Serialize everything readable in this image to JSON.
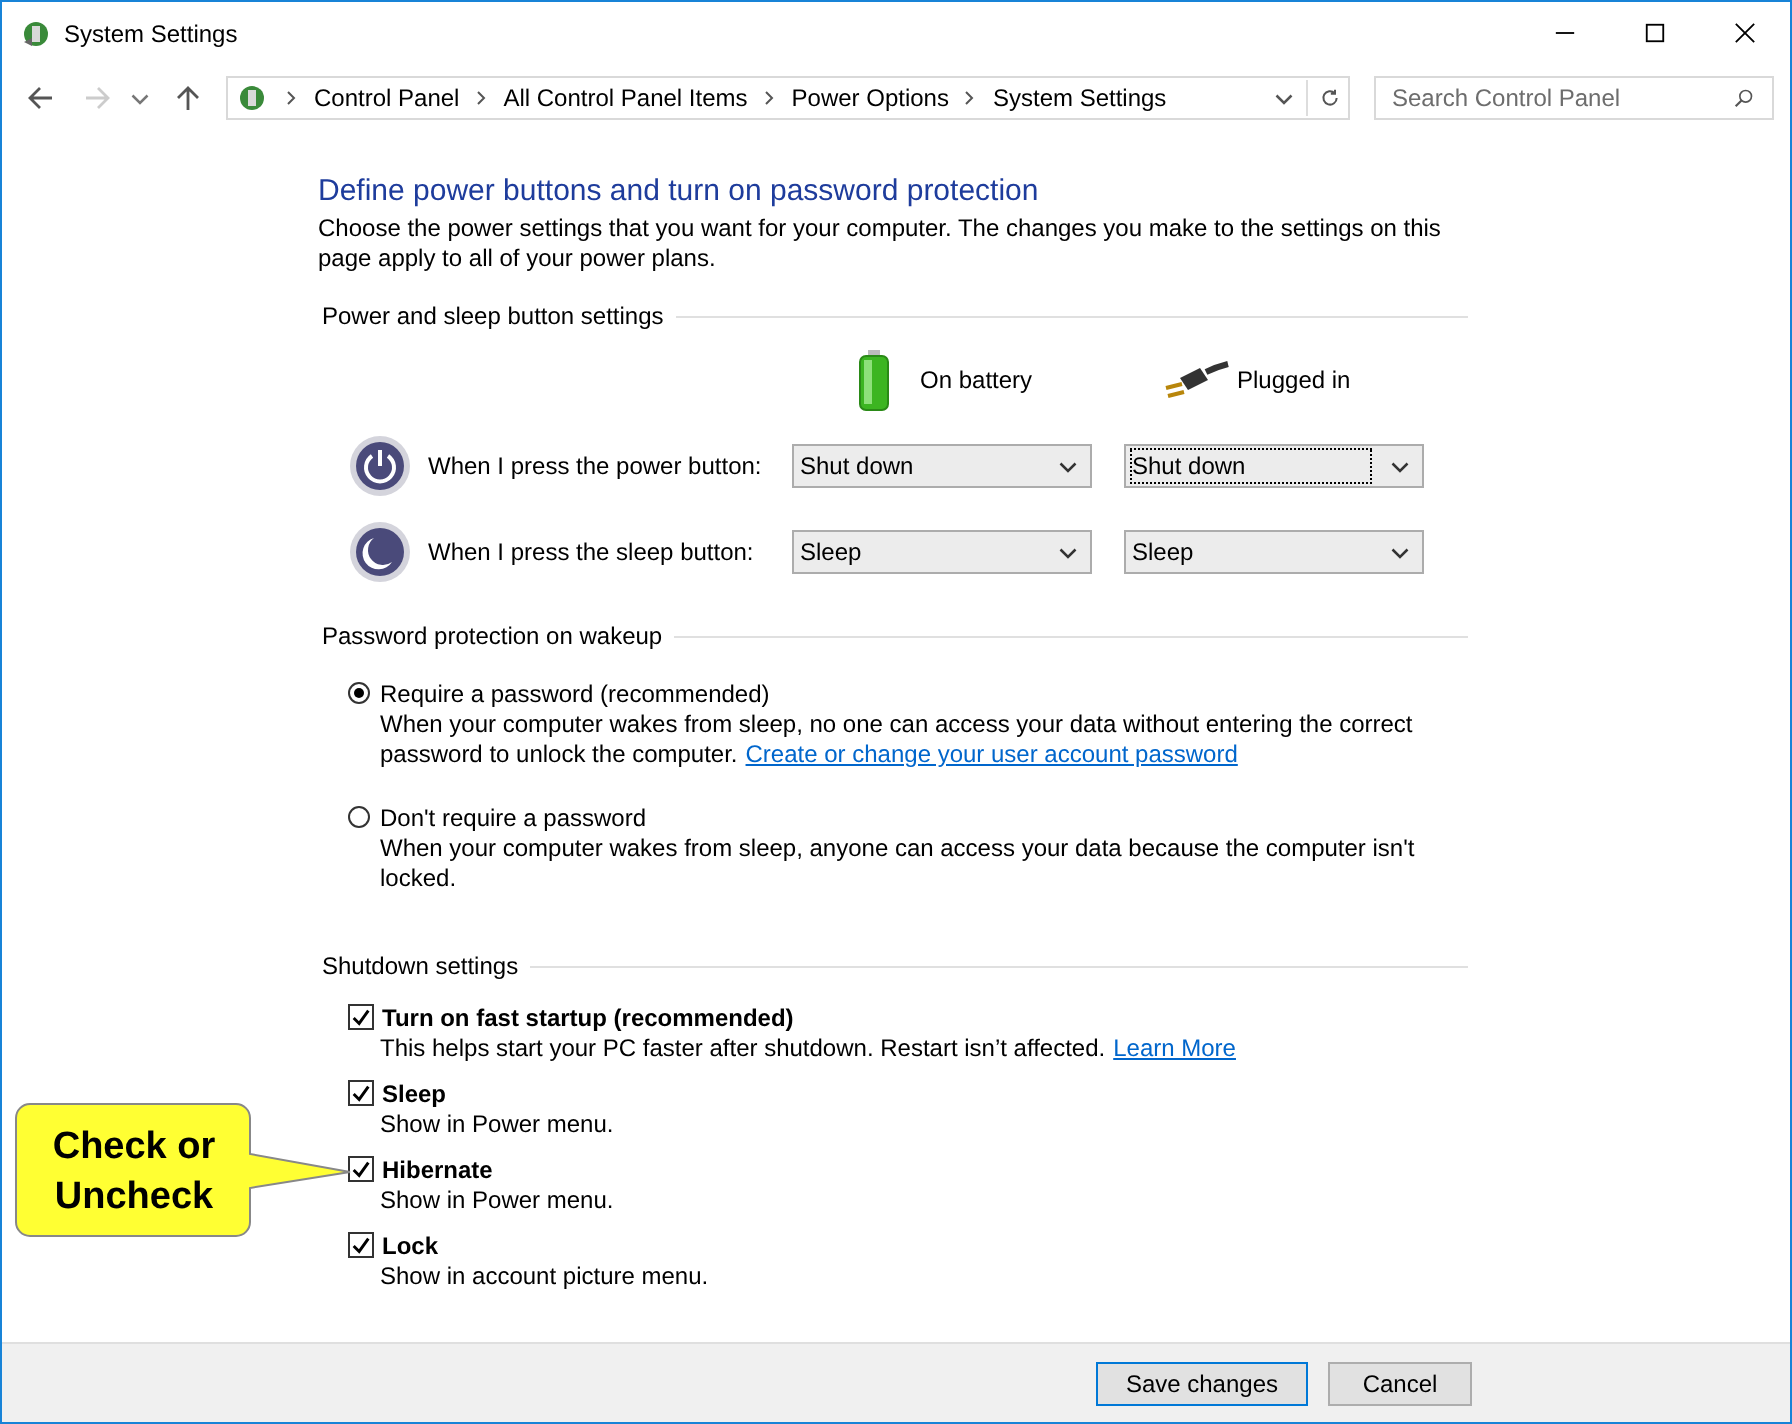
{
  "window": {
    "title": "System Settings"
  },
  "address_bar": {
    "breadcrumb": [
      "Control Panel",
      "All Control Panel Items",
      "Power Options",
      "System Settings"
    ],
    "search": {
      "placeholder": "Search Control Panel"
    }
  },
  "heading": "Define power buttons and turn on password protection",
  "intro": "Choose the power settings that you want for your computer. The changes you make to the settings on this page apply to all of your power plans.",
  "power_section": {
    "title": "Power and sleep button settings",
    "columns": [
      {
        "kind": "battery",
        "label": "On battery"
      },
      {
        "kind": "plug",
        "label": "Plugged in"
      }
    ],
    "rows": [
      {
        "kind": "power",
        "label": "When I press the power button:",
        "dropdowns": [
          {
            "value": "Shut down",
            "focused": false
          },
          {
            "value": "Shut down",
            "focused": true
          }
        ]
      },
      {
        "kind": "sleep",
        "label": "When I press the sleep button:",
        "dropdowns": [
          {
            "value": "Sleep",
            "focused": false
          },
          {
            "value": "Sleep",
            "focused": false
          }
        ]
      }
    ]
  },
  "password_section": {
    "title": "Password protection on wakeup",
    "options": [
      {
        "label": "Require a password (recommended)",
        "selected": true,
        "description": "When your computer wakes from sleep, no one can access your data without entering the correct password to unlock the computer.",
        "link": "Create or change your user account password"
      },
      {
        "label": "Don't require a password",
        "selected": false,
        "description": "When your computer wakes from sleep, anyone can access your data because the computer isn't locked."
      }
    ]
  },
  "shutdown_section": {
    "title": "Shutdown settings",
    "options": [
      {
        "label": "Turn on fast startup (recommended)",
        "checked": true,
        "description": "This helps start your PC faster after shutdown. Restart isn’t affected.",
        "link": "Learn More"
      },
      {
        "label": "Sleep",
        "checked": true,
        "description": "Show in Power menu."
      },
      {
        "label": "Hibernate",
        "checked": true,
        "description": "Show in Power menu."
      },
      {
        "label": "Lock",
        "checked": true,
        "description": "Show in account picture menu."
      }
    ]
  },
  "callout": {
    "text": "Check or Uncheck"
  },
  "buttons": [
    {
      "label": "Save changes",
      "focused": true
    },
    {
      "label": "Cancel",
      "focused": false
    }
  ]
}
